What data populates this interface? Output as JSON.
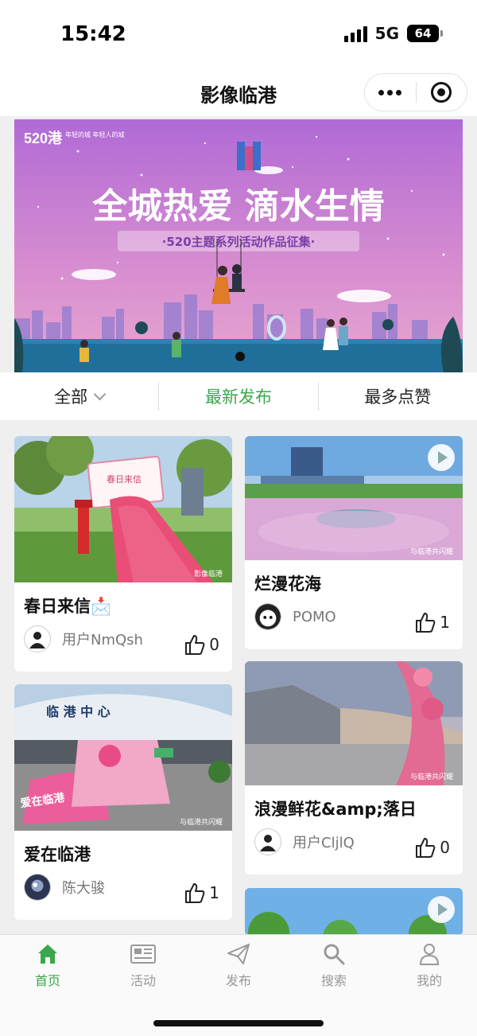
{
  "status_bar": {
    "time": "15:42",
    "network": "5G",
    "battery": "64"
  },
  "nav": {
    "title": "影像临港"
  },
  "banner": {
    "headline": "全城热爱 滴水生情",
    "subline": "·520主题系列活动作品征集·",
    "logo_text": "年轻的城 年轻人的城"
  },
  "filters": {
    "all": "全部",
    "latest": "最新发布",
    "most_liked": "最多点赞"
  },
  "cards": [
    {
      "title": "春日来信",
      "emoji": "📩",
      "user": "用户NmQsh",
      "likes": "0"
    },
    {
      "title": "烂漫花海",
      "user": "POMO",
      "likes": "1"
    },
    {
      "title": "爱在临港",
      "user": "陈大骏",
      "likes": "1"
    },
    {
      "title": "浪漫鲜花&amp;落日",
      "user": "用户CljlQ",
      "likes": "0"
    }
  ],
  "tabbar": {
    "home": "首页",
    "activity": "活动",
    "publish": "发布",
    "search": "搜索",
    "mine": "我的"
  },
  "colors": {
    "accent": "#3aa84a",
    "banner_top": "#b06ad6",
    "banner_bottom": "#e79ac9"
  }
}
